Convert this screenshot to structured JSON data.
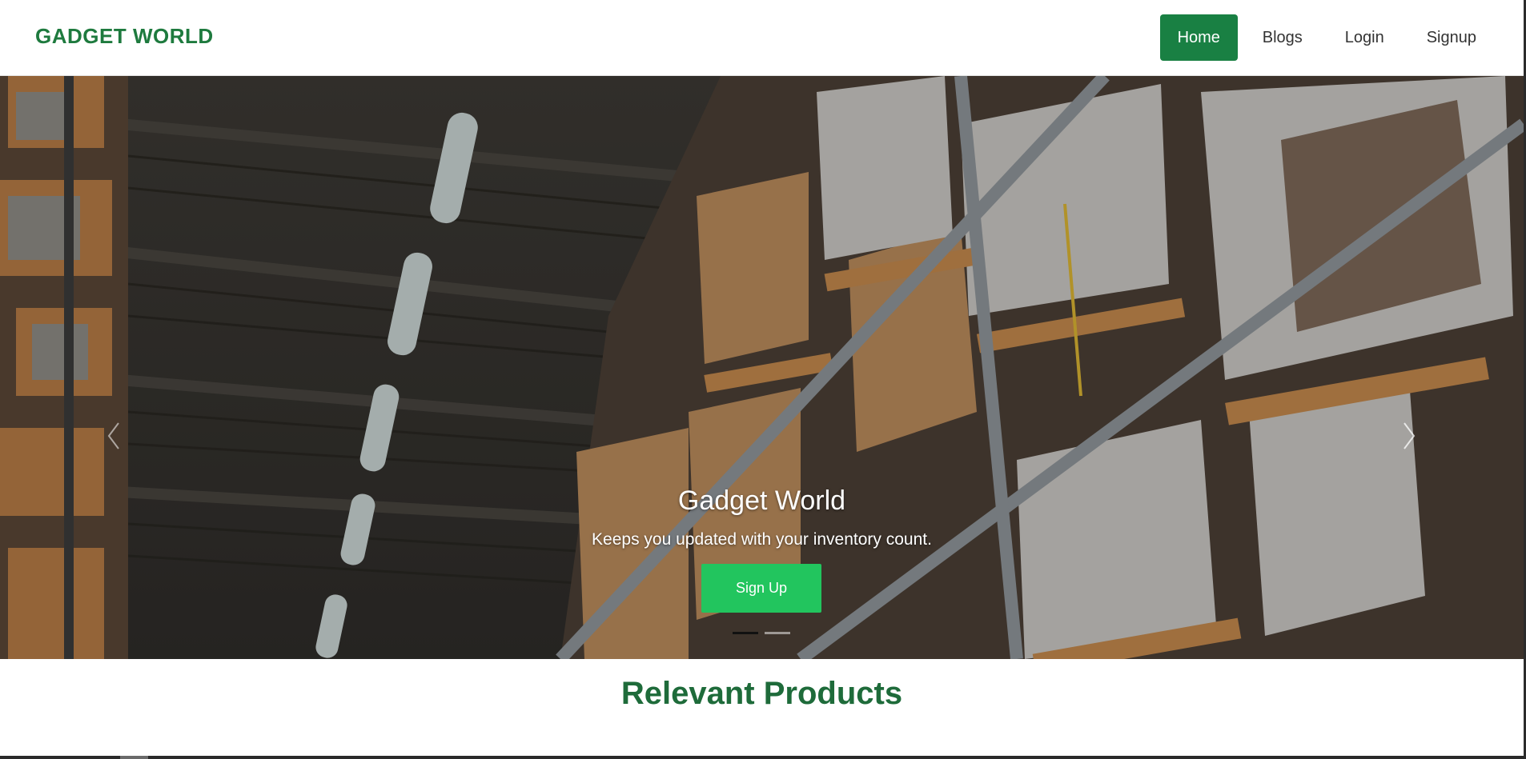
{
  "navbar": {
    "brand": "GADGET WORLD",
    "links": [
      {
        "label": "Home",
        "active": true
      },
      {
        "label": "Blogs",
        "active": false
      },
      {
        "label": "Login",
        "active": false
      },
      {
        "label": "Signup",
        "active": false
      }
    ]
  },
  "hero": {
    "title": "Gadget World",
    "subtitle": "Keeps you updated with your inventory count.",
    "button_label": "Sign Up",
    "slide_count": 2,
    "active_slide": 1
  },
  "section": {
    "title": "Relevant Products"
  },
  "colors": {
    "brand_green": "#1e7a3e",
    "active_nav_bg": "#198043",
    "cta_green": "#22c55e",
    "section_title": "#1e6b3a"
  },
  "icons": {
    "prev": "chevron-left-icon",
    "next": "chevron-right-icon"
  }
}
